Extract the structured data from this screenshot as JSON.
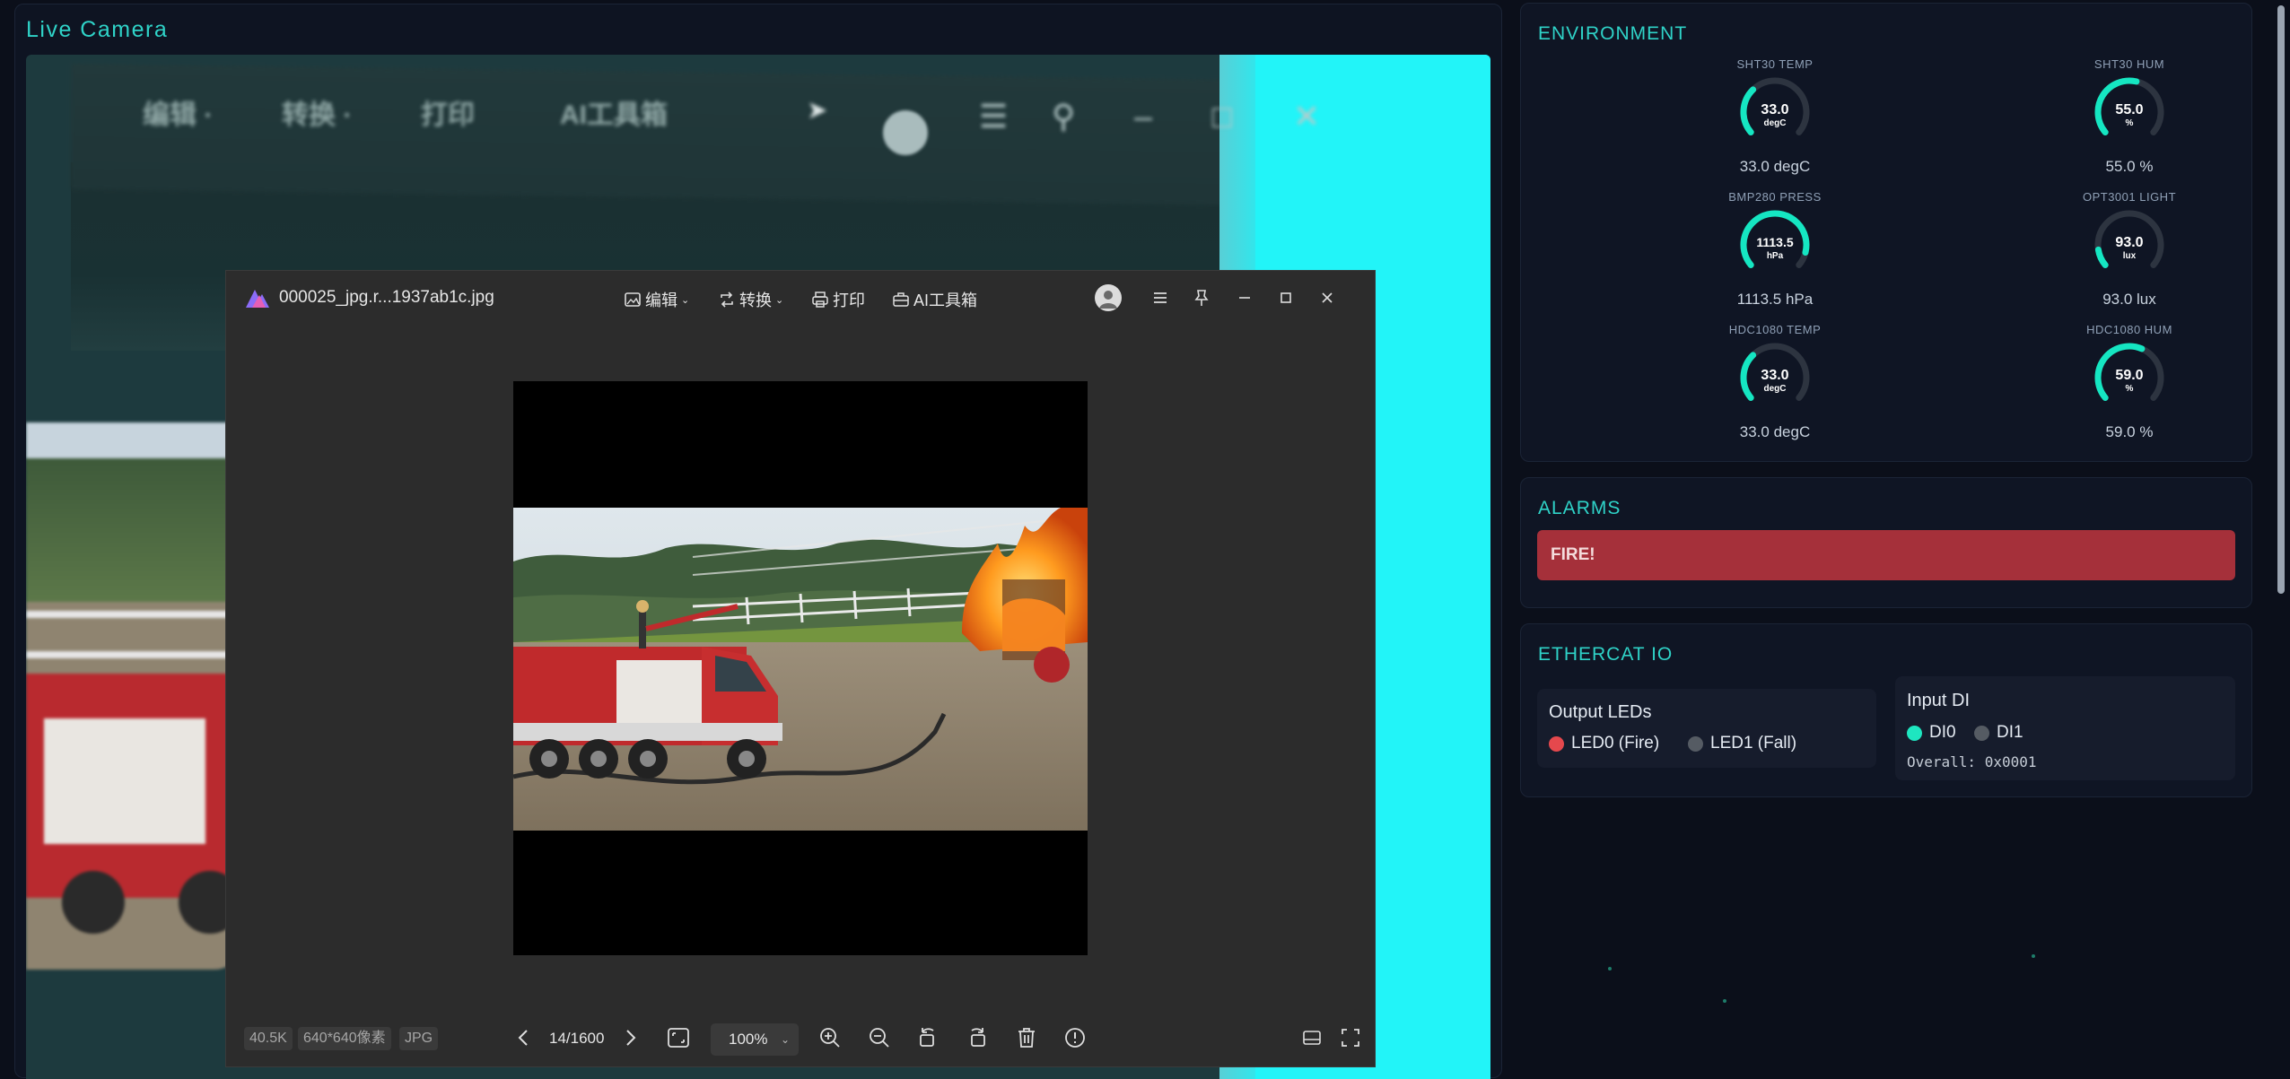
{
  "camera": {
    "title": "Live Camera",
    "blurred_toolbar": [
      "编辑 ·",
      "转换 ·",
      "打印",
      "AI工具箱"
    ]
  },
  "viewer": {
    "filename": "000025_jpg.r...1937ab1c.jpg",
    "menu": {
      "edit": "编辑",
      "convert": "转换",
      "print": "打印",
      "ai_tools": "AI工具箱"
    },
    "file_size": "40.5K",
    "dimensions": "640*640像素",
    "format": "JPG",
    "counter": "14/1600",
    "zoom": "100%"
  },
  "environment": {
    "title": "ENVIRONMENT",
    "sensors": [
      {
        "label": "SHT30 TEMP",
        "value": "33.0",
        "unit": "degC",
        "display": "33.0 degC",
        "fraction": 0.33
      },
      {
        "label": "SHT30 HUM",
        "value": "55.0",
        "unit": "%",
        "display": "55.0 %",
        "fraction": 0.55
      },
      {
        "label": "BMP280 PRESS",
        "value": "1113.5",
        "unit": "hPa",
        "display": "1113.5 hPa",
        "fraction": 0.9
      },
      {
        "label": "OPT3001 LIGHT",
        "value": "93.0",
        "unit": "lux",
        "display": "93.0 lux",
        "fraction": 0.12
      },
      {
        "label": "HDC1080 TEMP",
        "value": "33.0",
        "unit": "degC",
        "display": "33.0 degC",
        "fraction": 0.33
      },
      {
        "label": "HDC1080 HUM",
        "value": "59.0",
        "unit": "%",
        "display": "59.0 %",
        "fraction": 0.59
      }
    ]
  },
  "alarms": {
    "title": "ALARMS",
    "active": "FIRE!"
  },
  "ethercat": {
    "title": "ETHERCAT IO",
    "outputs": {
      "title": "Output LEDs",
      "items": [
        {
          "label": "LED0 (Fire)",
          "color": "#e5484d"
        },
        {
          "label": "LED1 (Fall)",
          "color": "#555b63"
        }
      ]
    },
    "inputs": {
      "title": "Input DI",
      "items": [
        {
          "label": "DI0",
          "color": "#1ee6c0"
        },
        {
          "label": "DI1",
          "color": "#555b63"
        }
      ],
      "overall": "Overall: 0x0001"
    }
  },
  "colors": {
    "accent": "#2fd3c8",
    "gauge": "#15e6c2",
    "alarm": "#a5303a"
  }
}
